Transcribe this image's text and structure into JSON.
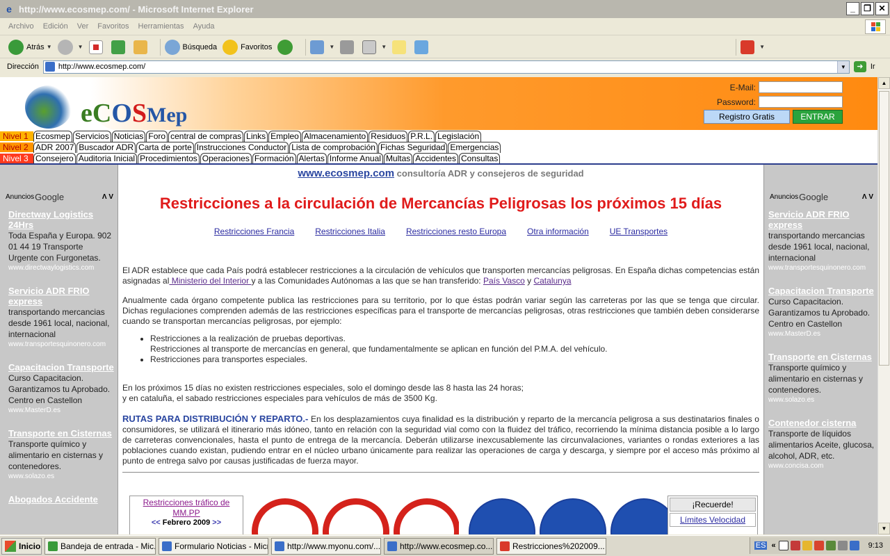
{
  "window": {
    "title": "http://www.ecosmep.com/ - Microsoft Internet Explorer",
    "min_label": "_",
    "max_label": "❐",
    "close_label": "✕"
  },
  "menu": [
    "Archivo",
    "Edición",
    "Ver",
    "Favoritos",
    "Herramientas",
    "Ayuda"
  ],
  "toolbar": {
    "back_label": "Atrás",
    "search_label": "Búsqueda",
    "favorites_label": "Favoritos"
  },
  "address": {
    "label": "Dirección",
    "url": "http://www.ecosmep.com/",
    "go_label": "Ir"
  },
  "header": {
    "logo_e": "eC",
    "logo_o": "O",
    "logo_s": "S",
    "logo_rest": "Mep",
    "email_label": "E-Mail:",
    "password_label": "Password:",
    "register_label": "Registro Gratis",
    "enter_label": "ENTRAR"
  },
  "nav": {
    "level1": {
      "label": "Nivel 1",
      "items": [
        "Ecosmep",
        "Servicios",
        "Noticias",
        "Foro",
        "central de compras",
        "Links",
        "Empleo",
        "Almacenamiento",
        "Residuos",
        "P.R.L.",
        "Legislación"
      ]
    },
    "level2": {
      "label": "Nivel 2",
      "items": [
        "ADR 2007",
        "Buscador ADR",
        "Carta de porte",
        "Instrucciones Conductor",
        "Lista de comprobación",
        "Fichas Seguridad",
        "Emergencias"
      ]
    },
    "level3": {
      "label": "Nivel 3",
      "items": [
        "Consejero",
        "Auditoria Inicial",
        "Procedimientos",
        "Operaciones",
        "Formación",
        "Alertas",
        "Informe Anual",
        "Multas",
        "Accidentes",
        "Consultas"
      ]
    }
  },
  "ads_header": {
    "anuncios": "Anuncios",
    "google": "Google",
    "arrows": "Λ V"
  },
  "left_ads": [
    {
      "title": "Directway Logistics 24Hrs",
      "desc": "Toda España y Europa. 902 01 44 19 Transporte Urgente con Furgonetas.",
      "url": "www.directwaylogistics.com"
    },
    {
      "title": "Servicio ADR FRIO express",
      "desc": "transportando mercancias desde 1961 local, nacional, internacional",
      "url": "www.transportesquinonero.com"
    },
    {
      "title": "Capacitacion Transporte",
      "desc": "Curso Capacitacion. Garantizamos tu Aprobado. Centro en Castellon",
      "url": "www.MasterD.es"
    },
    {
      "title": "Transporte en Cisternas",
      "desc": "Transporte químico y alimentario en cisternas y contenedores.",
      "url": "www.solazo.es"
    },
    {
      "title": "Abogados Accidente",
      "desc": "",
      "url": ""
    }
  ],
  "right_ads": [
    {
      "title": "Servicio ADR FRIO express",
      "desc": "transportando mercancias desde 1961 local, nacional, internacional",
      "url": "www.transportesquinonero.com"
    },
    {
      "title": "Capacitacion Transporte",
      "desc": "Curso Capacitacion. Garantizamos tu Aprobado. Centro en Castellon",
      "url": "www.MasterD.es"
    },
    {
      "title": "Transporte en Cisternas",
      "desc": "Transporte químico y alimentario en cisternas y contenedores.",
      "url": "www.solazo.es"
    },
    {
      "title": "Contenedor cisterna",
      "desc": "Transporte de líquidos alimentarios Aceite, glucosa, alcohol, ADR, etc.",
      "url": "www.concisa.com"
    }
  ],
  "main": {
    "slogan_site": "www.ecosmep.com",
    "slogan_rest": " consultoría ADR y consejeros de seguridad",
    "headline": "Restricciones a la circulación de Mercancías Peligrosas los próximos 15 días",
    "sublinks": [
      "Restricciones Francia",
      "Restricciones Italia",
      "Restricciones resto Europa",
      "Otra información",
      "UE Transportes"
    ],
    "p1_a": "El ADR establece que cada País podrá establecer restricciones a la circulación de vehículos que transporten mercancías peligrosas. En España dichas competencias están asignadas al",
    "p1_link1": " Ministerio del Interior ",
    "p1_b": "y a las Comunidades Autónomas a las que se han transferido: ",
    "p1_link2": "País Vasco",
    "p1_c": " y ",
    "p1_link3": "Catalunya",
    "p2": "Anualmente cada órgano competente publica las restricciones para su territorio, por lo que éstas podrán variar según las carreteras por las que se tenga que circular. Dichas regulaciones comprenden además de las restricciones específicas para el transporte de mercancías peligrosas, otras restricciones que también deben considerarse cuando se transportan mercancías peligrosas, por ejemplo:",
    "bullet1a": "Restricciones a la realización de pruebas deportivas.",
    "bullet1b": "Restricciones al transporte de mercancías en general, que fundamentalmente se aplican en función del P.M.A. del vehículo.",
    "bullet2": "Restricciones para transportes especiales.",
    "p3a": "En los próximos 15 días no existen restricciones especiales, solo el domingo desde las 8 hasta las 24 horas;",
    "p3b": "y en cataluña, el sabado restricciones especiales para vehículos de más de 3500 Kg.",
    "rutas_title": "RUTAS PARA DISTRIBUCIÓN Y REPARTO.-",
    "rutas_text": " En los desplazamientos cuya finalidad es la distribución y reparto de la mercancía peligrosa a sus destinatarios finales o consumidores, se utilizará el itinerario más idóneo, tanto en relación con la seguridad vial como con la fluidez del tráfico, recorriendo la mínima distancia posible a lo largo de carreteras convencionales, hasta el punto de entrega de la mercancía. Deberán utilizarse inexcusablemente las circunvalaciones, variantes o rondas exteriores a las poblaciones cuando existan, pudiendo entrar en el núcleo urbano únicamente para realizar las operaciones de carga y descarga, y siempre por el acceso más próximo al punto de entrega salvo por causas justificadas de fuerza mayor.",
    "cal_title": "Restricciones tráfico de MM.PP",
    "cal_prev": "<<",
    "cal_month": " Febrero 2009 ",
    "cal_next": ">>",
    "recuerde_title": "¡Recuerde!",
    "recuerde_link": "Límites Velocidad"
  },
  "taskbar": {
    "start": "Inicio",
    "tasks": [
      "Bandeja de entrada - Mic...",
      "Formulario Noticias - Micr...",
      "http://www.myonu.com/...",
      "http://www.ecosmep.co...",
      "Restricciones%202009..."
    ],
    "lang": "ES",
    "tray_arrows": "«",
    "clock": "9:13"
  },
  "colors": {
    "accent": "#ff8a10",
    "brand_blue": "#2a46a0",
    "headline_red": "#e01b1b"
  }
}
